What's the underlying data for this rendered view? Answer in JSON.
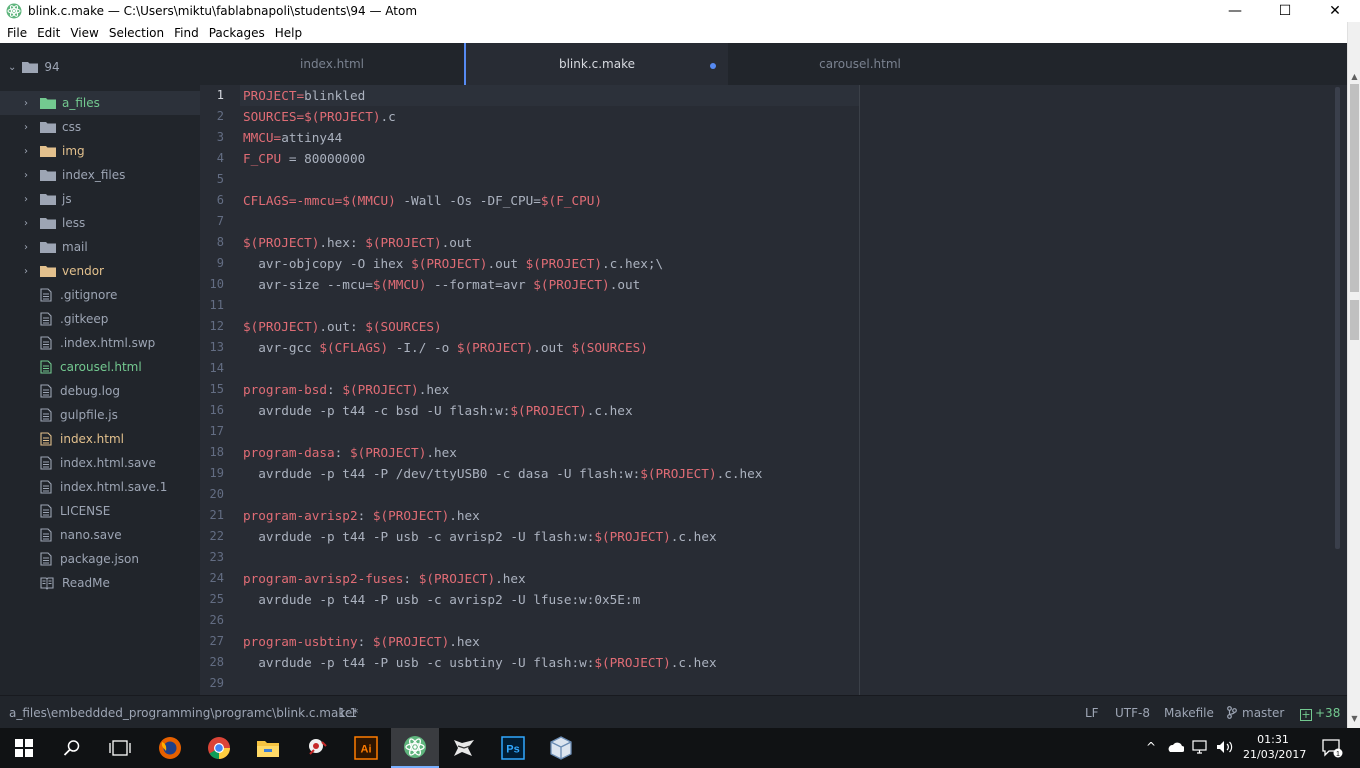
{
  "window": {
    "title": "blink.c.make — C:\\Users\\miktu\\fablabnapoli\\students\\94 — Atom",
    "minimize": "—",
    "maximize": "☐",
    "close": "✕"
  },
  "menu": [
    "File",
    "Edit",
    "View",
    "Selection",
    "Find",
    "Packages",
    "Help"
  ],
  "tree": {
    "root": "94",
    "items": [
      {
        "label": "a_files",
        "kind": "folder",
        "color": "#73c990",
        "selected": true
      },
      {
        "label": "css",
        "kind": "folder",
        "color": "#9da5b4"
      },
      {
        "label": "img",
        "kind": "folder",
        "color": "#e2c08d"
      },
      {
        "label": "index_files",
        "kind": "folder",
        "color": "#9da5b4"
      },
      {
        "label": "js",
        "kind": "folder",
        "color": "#9da5b4"
      },
      {
        "label": "less",
        "kind": "folder",
        "color": "#9da5b4"
      },
      {
        "label": "mail",
        "kind": "folder",
        "color": "#9da5b4"
      },
      {
        "label": "vendor",
        "kind": "folder",
        "color": "#e2c08d"
      },
      {
        "label": ".gitignore",
        "kind": "file",
        "color": "#9da5b4"
      },
      {
        "label": ".gitkeep",
        "kind": "file",
        "color": "#9da5b4"
      },
      {
        "label": ".index.html.swp",
        "kind": "file",
        "color": "#9da5b4"
      },
      {
        "label": "carousel.html",
        "kind": "file",
        "color": "#73c990"
      },
      {
        "label": "debug.log",
        "kind": "file",
        "color": "#9da5b4"
      },
      {
        "label": "gulpfile.js",
        "kind": "file",
        "color": "#9da5b4"
      },
      {
        "label": "index.html",
        "kind": "file",
        "color": "#e2c08d"
      },
      {
        "label": "index.html.save",
        "kind": "file",
        "color": "#9da5b4"
      },
      {
        "label": "index.html.save.1",
        "kind": "file",
        "color": "#9da5b4"
      },
      {
        "label": "LICENSE",
        "kind": "file",
        "color": "#9da5b4"
      },
      {
        "label": "nano.save",
        "kind": "file",
        "color": "#9da5b4"
      },
      {
        "label": "package.json",
        "kind": "file",
        "color": "#9da5b4"
      },
      {
        "label": "ReadMe",
        "kind": "book",
        "color": "#9da5b4"
      }
    ]
  },
  "tabs": [
    {
      "label": "index.html",
      "active": false,
      "modified": false
    },
    {
      "label": "blink.c.make",
      "active": true,
      "modified": true
    },
    {
      "label": "carousel.html",
      "active": false,
      "modified": false
    }
  ],
  "editor": {
    "lines": [
      [
        [
          "v",
          "PROJECT="
        ],
        [
          "p",
          "blinkled"
        ]
      ],
      [
        [
          "v",
          "SOURCES=$(PROJECT)"
        ],
        [
          "p",
          ".c"
        ]
      ],
      [
        [
          "v",
          "MMCU="
        ],
        [
          "p",
          "attiny44"
        ]
      ],
      [
        [
          "v",
          "F_CPU"
        ],
        [
          "p",
          " = 80000000"
        ]
      ],
      [],
      [
        [
          "v",
          "CFLAGS=-mmcu=$(MMCU)"
        ],
        [
          "p",
          " -Wall -Os -DF_CPU="
        ],
        [
          "v",
          "$(F_CPU)"
        ]
      ],
      [],
      [
        [
          "v",
          "$(PROJECT)"
        ],
        [
          "p",
          ".hex: "
        ],
        [
          "v",
          "$(PROJECT)"
        ],
        [
          "p",
          ".out"
        ]
      ],
      [
        [
          "p",
          "  avr-objcopy -O ihex "
        ],
        [
          "v",
          "$(PROJECT)"
        ],
        [
          "p",
          ".out "
        ],
        [
          "v",
          "$(PROJECT)"
        ],
        [
          "p",
          ".c.hex;\\"
        ]
      ],
      [
        [
          "p",
          "  avr-size --mcu="
        ],
        [
          "v",
          "$(MMCU)"
        ],
        [
          "p",
          " --format=avr "
        ],
        [
          "v",
          "$(PROJECT)"
        ],
        [
          "p",
          ".out"
        ]
      ],
      [],
      [
        [
          "v",
          "$(PROJECT)"
        ],
        [
          "p",
          ".out: "
        ],
        [
          "v",
          "$(SOURCES)"
        ]
      ],
      [
        [
          "p",
          "  avr-gcc "
        ],
        [
          "v",
          "$(CFLAGS)"
        ],
        [
          "p",
          " -I./ -o "
        ],
        [
          "v",
          "$(PROJECT)"
        ],
        [
          "p",
          ".out "
        ],
        [
          "v",
          "$(SOURCES)"
        ]
      ],
      [],
      [
        [
          "v",
          "program-bsd"
        ],
        [
          "p",
          ": "
        ],
        [
          "v",
          "$(PROJECT)"
        ],
        [
          "p",
          ".hex"
        ]
      ],
      [
        [
          "p",
          "  avrdude -p t44 -c bsd -U flash:w:"
        ],
        [
          "v",
          "$(PROJECT)"
        ],
        [
          "p",
          ".c.hex"
        ]
      ],
      [],
      [
        [
          "v",
          "program-dasa"
        ],
        [
          "p",
          ": "
        ],
        [
          "v",
          "$(PROJECT)"
        ],
        [
          "p",
          ".hex"
        ]
      ],
      [
        [
          "p",
          "  avrdude -p t44 -P /dev/ttyUSB0 -c dasa -U flash:w:"
        ],
        [
          "v",
          "$(PROJECT)"
        ],
        [
          "p",
          ".c.hex"
        ]
      ],
      [],
      [
        [
          "v",
          "program-avrisp2"
        ],
        [
          "p",
          ": "
        ],
        [
          "v",
          "$(PROJECT)"
        ],
        [
          "p",
          ".hex"
        ]
      ],
      [
        [
          "p",
          "  avrdude -p t44 -P usb -c avrisp2 -U flash:w:"
        ],
        [
          "v",
          "$(PROJECT)"
        ],
        [
          "p",
          ".c.hex"
        ]
      ],
      [],
      [
        [
          "v",
          "program-avrisp2-fuses"
        ],
        [
          "p",
          ": "
        ],
        [
          "v",
          "$(PROJECT)"
        ],
        [
          "p",
          ".hex"
        ]
      ],
      [
        [
          "p",
          "  avrdude -p t44 -P usb -c avrisp2 -U lfuse:w:0x5E:m"
        ]
      ],
      [],
      [
        [
          "v",
          "program-usbtiny"
        ],
        [
          "p",
          ": "
        ],
        [
          "v",
          "$(PROJECT)"
        ],
        [
          "p",
          ".hex"
        ]
      ],
      [
        [
          "p",
          "  avrdude -p t44 -P usb -c usbtiny -U flash:w:"
        ],
        [
          "v",
          "$(PROJECT)"
        ],
        [
          "p",
          ".c.hex"
        ]
      ],
      []
    ]
  },
  "status": {
    "path": "a_files\\embeddded_programming\\programc\\blink.c.make*",
    "cursor": "1:1",
    "line_ending": "LF",
    "encoding": "UTF-8",
    "grammar": "Makefile",
    "branch": "master",
    "diff": "+38"
  },
  "taskbar": {
    "time": "01:31",
    "date": "21/03/2017",
    "notifications": "1"
  },
  "colors": {
    "accent": "#568af2",
    "variable": "#e06c75",
    "git_added": "#73c990",
    "git_modified": "#e2c08d"
  }
}
